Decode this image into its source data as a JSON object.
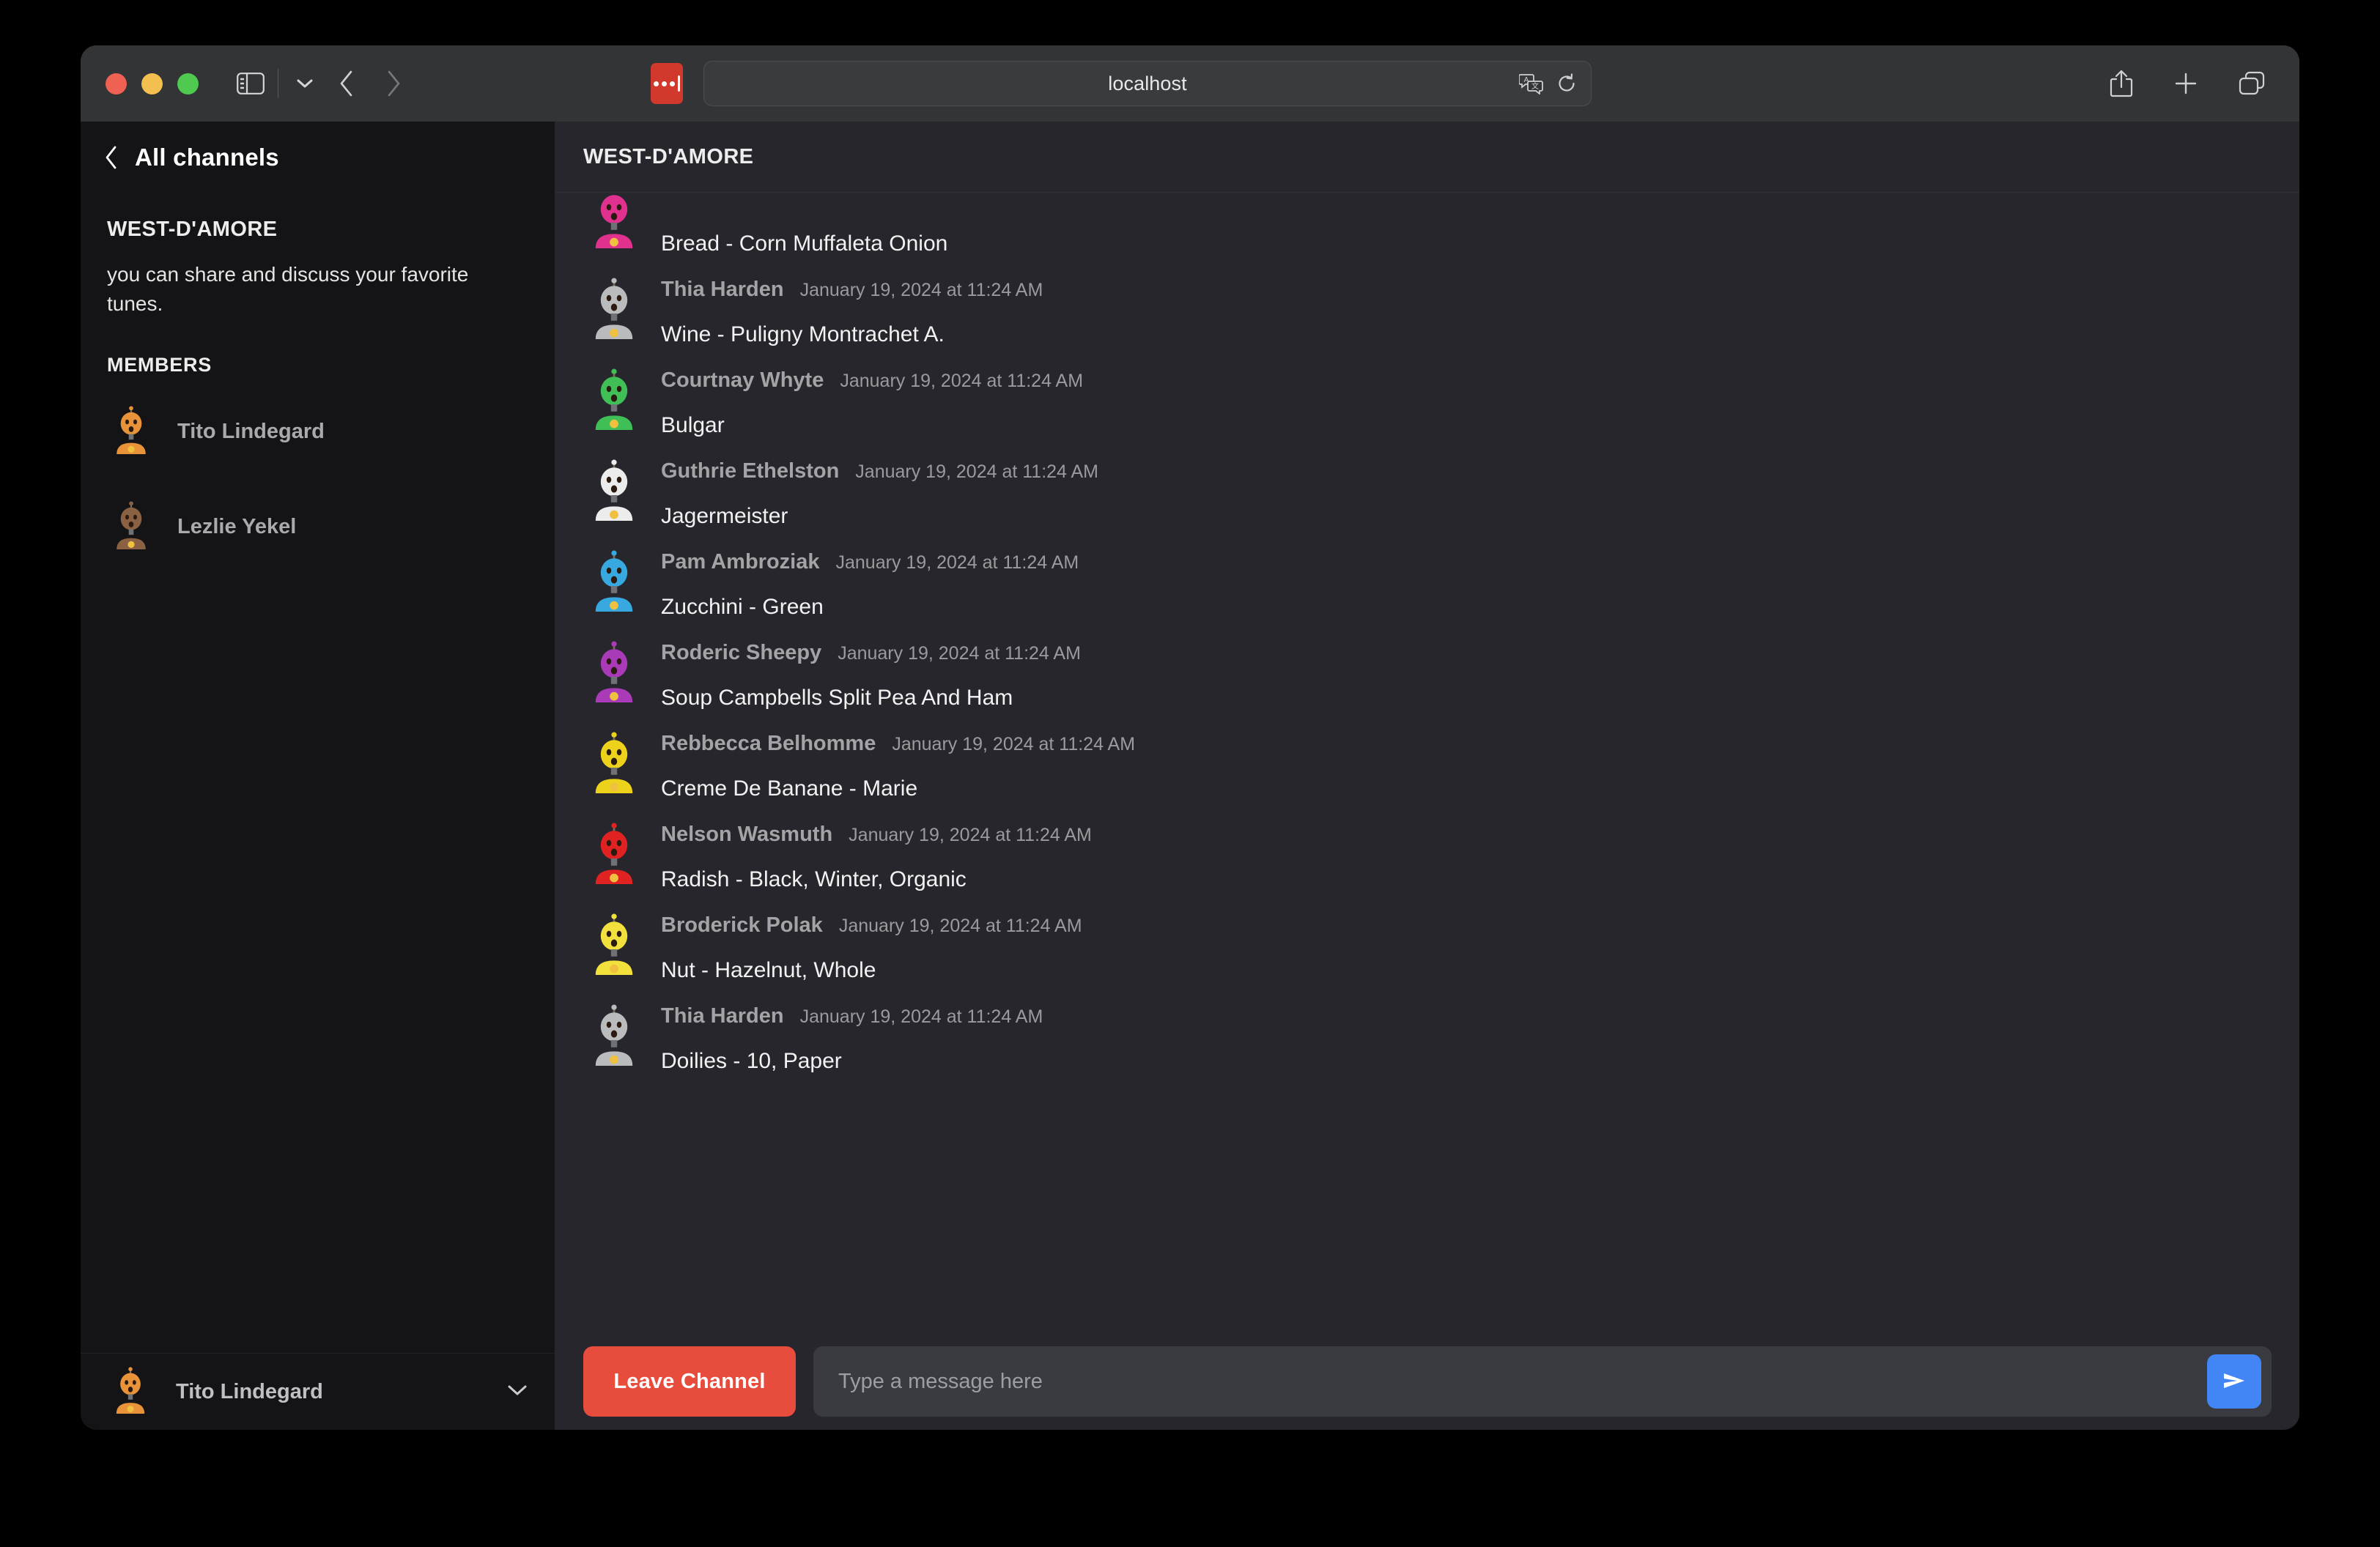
{
  "browser": {
    "url": "localhost",
    "traffic_lights": [
      "close-red",
      "minimize-yellow",
      "maximize-green"
    ],
    "icons": {
      "sidebar_toggle": "sidebar-icon",
      "tabgroup_chevron": "chevron-down-icon",
      "back": "back-arrow-icon",
      "forward": "forward-arrow-icon",
      "extension": "extension-icon",
      "translate": "translate-icon",
      "reload": "reload-icon",
      "share": "share-icon",
      "new_tab": "plus-icon",
      "tab_overview": "tab-overview-icon"
    }
  },
  "sidebar": {
    "back_label": "All channels",
    "channel_name": "WEST-D'AMORE",
    "channel_description": "you can share and discuss your favorite tunes.",
    "members_title": "MEMBERS",
    "members": [
      {
        "name": "Tito Lindegard",
        "avatar_color": "#e8933a"
      },
      {
        "name": "Lezlie Yekel",
        "avatar_color": "#8a6243"
      }
    ],
    "footer": {
      "name": "Tito Lindegard",
      "avatar_color": "#e8933a",
      "chevron": "chevron-down-icon"
    }
  },
  "main": {
    "channel_title": "WEST-D'AMORE",
    "messages": [
      {
        "author": "",
        "time": "",
        "text": "Bread - Corn Muffaleta Onion",
        "avatar_color": "#e0318f",
        "clipped": true
      },
      {
        "author": "Thia Harden",
        "time": "January 19, 2024 at 11:24 AM",
        "text": "Wine - Puligny Montrachet A.",
        "avatar_color": "#b9bbbd"
      },
      {
        "author": "Courtnay Whyte",
        "time": "January 19, 2024 at 11:24 AM",
        "text": "Bulgar",
        "avatar_color": "#3fbf56"
      },
      {
        "author": "Guthrie Ethelston",
        "time": "January 19, 2024 at 11:24 AM",
        "text": "Jagermeister",
        "avatar_color": "#ececec"
      },
      {
        "author": "Pam Ambroziak",
        "time": "January 19, 2024 at 11:24 AM",
        "text": "Zucchini - Green",
        "avatar_color": "#37a8e0"
      },
      {
        "author": "Roderic Sheepy",
        "time": "January 19, 2024 at 11:24 AM",
        "text": "Soup Campbells Split Pea And Ham",
        "avatar_color": "#a93ab8"
      },
      {
        "author": "Rebbecca Belhomme",
        "time": "January 19, 2024 at 11:24 AM",
        "text": "Creme De Banane - Marie",
        "avatar_color": "#edd21c"
      },
      {
        "author": "Nelson Wasmuth",
        "time": "January 19, 2024 at 11:24 AM",
        "text": "Radish - Black, Winter, Organic",
        "avatar_color": "#e02222"
      },
      {
        "author": "Broderick Polak",
        "time": "January 19, 2024 at 11:24 AM",
        "text": "Nut - Hazelnut, Whole",
        "avatar_color": "#f2e13c"
      },
      {
        "author": "Thia Harden",
        "time": "January 19, 2024 at 11:24 AM",
        "text": "Doilies - 10, Paper",
        "avatar_color": "#b9bbbd"
      }
    ]
  },
  "composer": {
    "leave_label": "Leave Channel",
    "input_value": "",
    "input_placeholder": "Type a message here",
    "send_icon": "send-icon"
  },
  "colors": {
    "accent_send": "#4285f4",
    "danger": "#e74c3c",
    "sidebar_bg": "#141416",
    "main_bg": "#26262c",
    "toolbar_bg": "#333436"
  }
}
